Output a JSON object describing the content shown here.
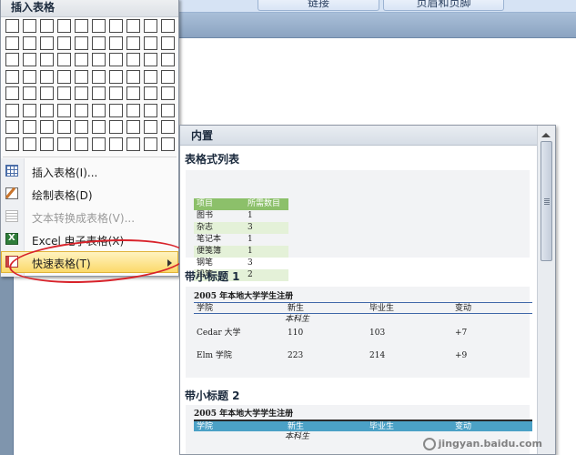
{
  "ribbon": {
    "tabs": [
      "链接",
      "页眉和页脚"
    ]
  },
  "insert_table_menu": {
    "title": "插入表格",
    "grid": {
      "columns": 10,
      "rows": 8
    },
    "items": [
      {
        "label": "插入表格(I)...",
        "icon": "insert-table-icon",
        "enabled": true
      },
      {
        "label": "绘制表格(D)",
        "icon": "draw-table-icon",
        "enabled": true
      },
      {
        "label": "文本转换成表格(V)...",
        "icon": "convert-text-icon",
        "enabled": false
      },
      {
        "label": "Excel 电子表格(X)",
        "icon": "excel-icon",
        "enabled": true
      },
      {
        "label": "快速表格(T)",
        "icon": "quick-table-icon",
        "enabled": true,
        "selected": true,
        "has_submenu": true
      }
    ]
  },
  "quick_tables": {
    "header": "内置",
    "sections": [
      {
        "title": "表格式列表",
        "header": [
          "项目",
          "所需数目"
        ],
        "rows": [
          [
            "图书",
            "1"
          ],
          [
            "杂志",
            "3"
          ],
          [
            "笔记本",
            "1"
          ],
          [
            "便笺簿",
            "1"
          ],
          [
            "钢笔",
            "3"
          ],
          [
            "铅笔",
            "2"
          ]
        ]
      },
      {
        "title": "带小标题 1",
        "caption": "2005 年本地大学学生注册",
        "header": [
          "学院",
          "新生",
          "毕业生",
          "变动"
        ],
        "subheading": "本科生",
        "rows": [
          [
            "Cedar 大学",
            "110",
            "103",
            "+7"
          ],
          [
            "Elm 学院",
            "223",
            "214",
            "+9"
          ]
        ]
      },
      {
        "title": "带小标题 2",
        "caption": "2005 年本地大学学生注册",
        "header": [
          "学院",
          "新生",
          "毕业生",
          "变动"
        ],
        "subheading": "本科生"
      }
    ]
  },
  "watermark": "jingyan.baidu.com"
}
